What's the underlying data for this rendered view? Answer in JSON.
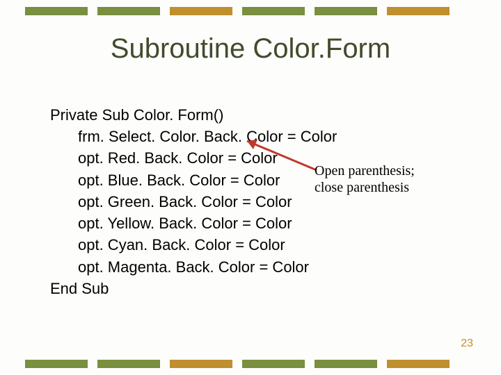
{
  "title": "Subroutine Color.Form",
  "code": {
    "l0": "Private Sub Color. Form()",
    "l1": "frm. Select. Color. Back. Color = Color",
    "l2": "opt. Red. Back. Color = Color",
    "l3": "opt. Blue. Back. Color = Color",
    "l4": "opt. Green. Back. Color = Color",
    "l5": "opt. Yellow. Back. Color = Color",
    "l6": "opt. Cyan. Back. Color = Color",
    "l7": "opt. Magenta. Back. Color = Color",
    "l8": "End Sub"
  },
  "annotation": {
    "line1": "Open parenthesis;",
    "line2": "close parenthesis"
  },
  "page_number": "23",
  "colors": {
    "green": "#7a8f3f",
    "gold": "#c08f2e"
  }
}
